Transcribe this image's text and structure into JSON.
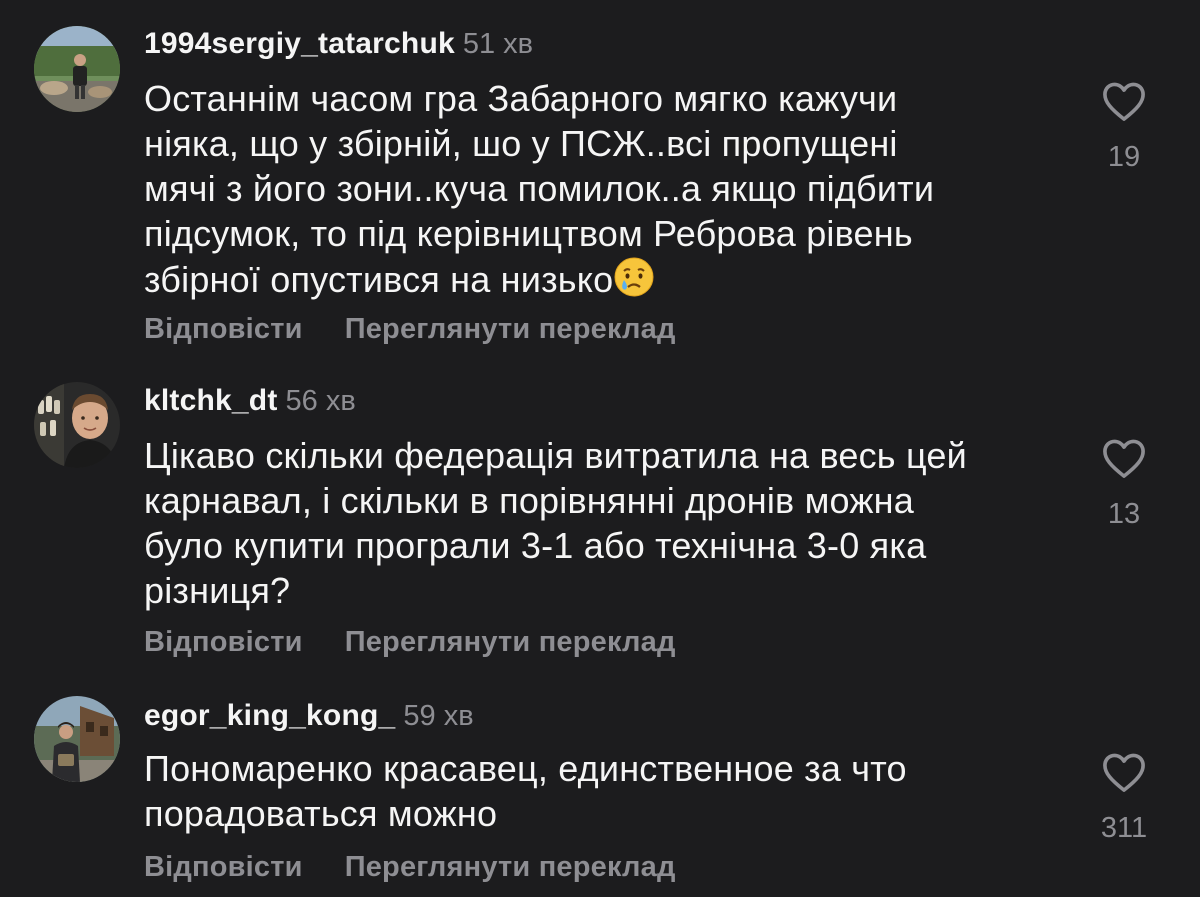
{
  "comments": [
    {
      "username": "1994sergiy_tatarchuk",
      "time": "51 хв",
      "text_lines": [
        "Останнім часом гра Забарного мягко кажучи",
        "ніяка, що у збірній, шо у ПСЖ..всі пропущені",
        "мячі з його зони..куча помилок..а якщо підбити",
        "підсумок, то під керівництвом Реброва рівень",
        "збірної опустився на низько"
      ],
      "emoji": "crying-face-emoji",
      "likes": "19",
      "reply_label": "Відповісти",
      "translate_label": "Переглянути переклад"
    },
    {
      "username": "kltchk_dt",
      "time": "56 хв",
      "text_lines": [
        "Цікаво скільки федерація витратила на весь цей",
        "карнавал, і скільки в порівнянні дронів можна",
        "було купити програли 3-1 або технічна 3-0 яка",
        "різниця?"
      ],
      "likes": "13",
      "reply_label": "Відповісти",
      "translate_label": "Переглянути переклад"
    },
    {
      "username": "egor_king_kong_",
      "time": "59 хв",
      "text_lines": [
        "Пономаренко красавец, единственное за что",
        "порадоваться можно"
      ],
      "likes": "311",
      "reply_label": "Відповісти",
      "translate_label": "Переглянути переклад"
    }
  ],
  "colors": {
    "background": "#1c1c1e",
    "text": "#f5f5f5",
    "secondary": "#8e8e93"
  },
  "icons": {
    "like": "heart-outline-icon"
  }
}
